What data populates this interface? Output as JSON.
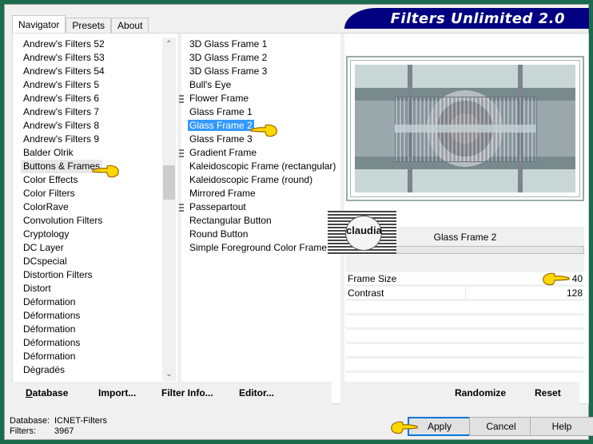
{
  "window": {
    "banner_title": "Filters Unlimited 2.0",
    "background_color": "#1b6b4e",
    "banner_color": "#000080"
  },
  "tabs": [
    {
      "label": "Navigator",
      "active": true
    },
    {
      "label": "Presets",
      "active": false
    },
    {
      "label": "About",
      "active": false
    }
  ],
  "categories": {
    "items": [
      "Andrew's Filters 52",
      "Andrew's Filters 53",
      "Andrew's Filters 54",
      "Andrew's Filters 5",
      "Andrew's Filters 6",
      "Andrew's Filters 7",
      "Andrew's Filters 8",
      "Andrew's Filters 9",
      "Balder Olrik",
      "Buttons & Frames",
      "Color Effects",
      "Color Filters",
      "ColorRave",
      "Convolution Filters",
      "Cryptology",
      "DC Layer",
      "DCspecial",
      "Distortion Filters",
      "Distort",
      "Déformation",
      "Déformations",
      "Déformation",
      "Déformations",
      "Déformation",
      "Dégradés"
    ],
    "selected": "Buttons & Frames"
  },
  "filters": {
    "items": [
      {
        "label": "3D Glass Frame 1",
        "grip": false
      },
      {
        "label": "3D Glass Frame 2",
        "grip": false
      },
      {
        "label": "3D Glass Frame 3",
        "grip": false
      },
      {
        "label": "Bull's Eye",
        "grip": false
      },
      {
        "label": "Flower Frame",
        "grip": true
      },
      {
        "label": "Glass Frame 1",
        "grip": false
      },
      {
        "label": "Glass Frame 2",
        "grip": false
      },
      {
        "label": "Glass Frame 3",
        "grip": false
      },
      {
        "label": "Gradient Frame",
        "grip": true
      },
      {
        "label": "Kaleidoscopic Frame (rectangular)",
        "grip": false
      },
      {
        "label": "Kaleidoscopic Frame (round)",
        "grip": false
      },
      {
        "label": "Mirrored Frame",
        "grip": false
      },
      {
        "label": "Passepartout",
        "grip": true
      },
      {
        "label": "Rectangular Button",
        "grip": false
      },
      {
        "label": "Round Button",
        "grip": false
      },
      {
        "label": "Simple Foreground Color Frame",
        "grip": false
      }
    ],
    "selected": "Glass Frame 2",
    "selection_color": "#3399ff"
  },
  "preview": {
    "filter_title": "Glass Frame 2",
    "watermark_text": "claudia"
  },
  "params": [
    {
      "label": "Frame Size",
      "value": "40",
      "fraction": 0.157
    },
    {
      "label": "Contrast",
      "value": "128",
      "fraction": 0.502
    }
  ],
  "toolbar_left": {
    "database": "Database",
    "import": "Import...",
    "filter_info": "Filter Info...",
    "editor": "Editor..."
  },
  "toolbar_right": {
    "randomize": "Randomize",
    "reset": "Reset"
  },
  "status": {
    "database_label": "Database:",
    "database_value": "ICNET-Filters",
    "filters_label": "Filters:",
    "filters_value": "3967"
  },
  "buttons": {
    "apply": "Apply",
    "cancel": "Cancel",
    "help": "Help"
  }
}
